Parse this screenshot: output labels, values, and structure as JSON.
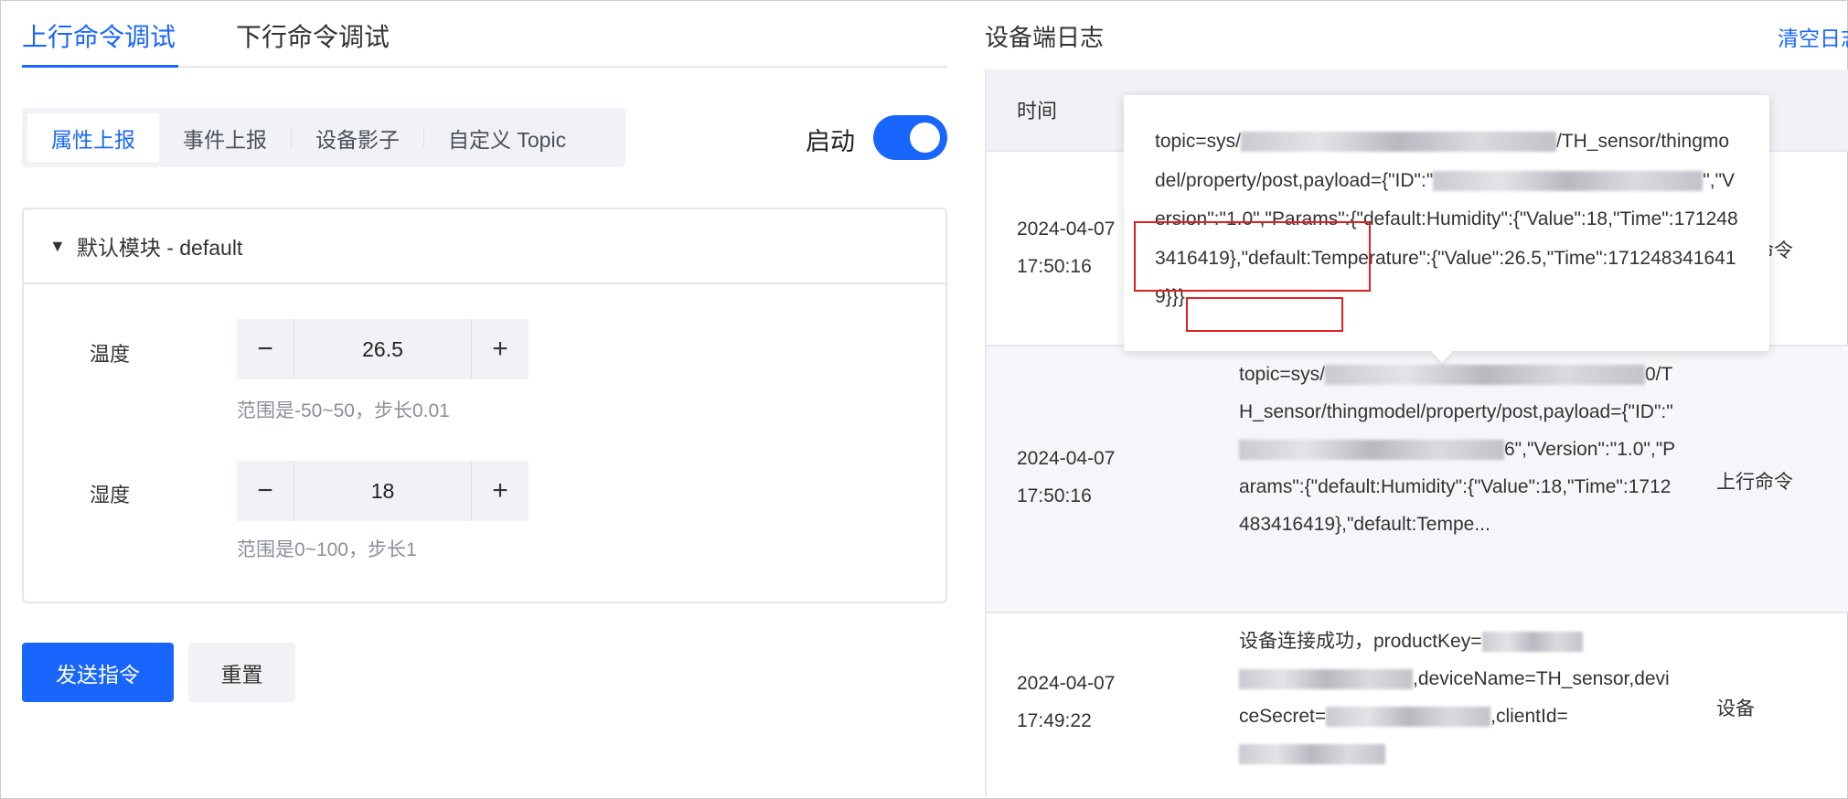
{
  "tabs": [
    {
      "label": "上行命令调试",
      "active": true
    },
    {
      "label": "下行命令调试",
      "active": false
    }
  ],
  "segments": [
    {
      "label": "属性上报",
      "active": true
    },
    {
      "label": "事件上报"
    },
    {
      "label": "设备影子"
    },
    {
      "label": "自定义 Topic"
    }
  ],
  "toggle": {
    "label": "启动",
    "on": true
  },
  "module": {
    "title": "默认模块 - default",
    "icon": "caret-down-icon"
  },
  "fields": [
    {
      "label": "温度",
      "value": "26.5",
      "hint": "范围是-50~50，步长0.01"
    },
    {
      "label": "湿度",
      "value": "18",
      "hint": "范围是0~100，步长1"
    }
  ],
  "stepper": {
    "minus": "−",
    "plus": "+"
  },
  "actions": {
    "send": "发送指令",
    "reset": "重置"
  },
  "log": {
    "title": "设备端日志",
    "clear": "清空日志",
    "header_time": "时间",
    "rows": [
      {
        "time": "2024-04-07 17:50:16",
        "type": "上行命令"
      },
      {
        "time": "2024-04-07 17:50:16",
        "type": "上行命令",
        "c1": "topic=sys/",
        "c2": "0/TH_sensor/thingmodel/property/post,payload={\"ID\":\"",
        "c3": "6\",\"Version\":\"1.0\",\"Params\":{\"default:Humidity\":{\"Value\":18,\"Time\":1712483416419},\"default:Tempe..."
      },
      {
        "time": "2024-04-07 17:49:22",
        "type": "设备",
        "c1": "设备连接成功，productKey=",
        "c2": ",deviceName=TH_sensor,deviceSecret=",
        "c3": ",clientId="
      }
    ]
  },
  "tooltip": {
    "p1": "topic=sys/",
    "p2": "/TH_sensor/thingmodel/property/post,payload={\"ID\":\"",
    "p3": "\",\"Version\":\"1.0\",\"Params\":{\"default:Humidity\":{\"Value\":18,\"Time\":1712483416419},\"default:Temperature\":{\"Value\":26.5,\"Time\":1712483416419}}}"
  },
  "colors": {
    "primary": "#1966ff",
    "highlight": "#e02020"
  }
}
